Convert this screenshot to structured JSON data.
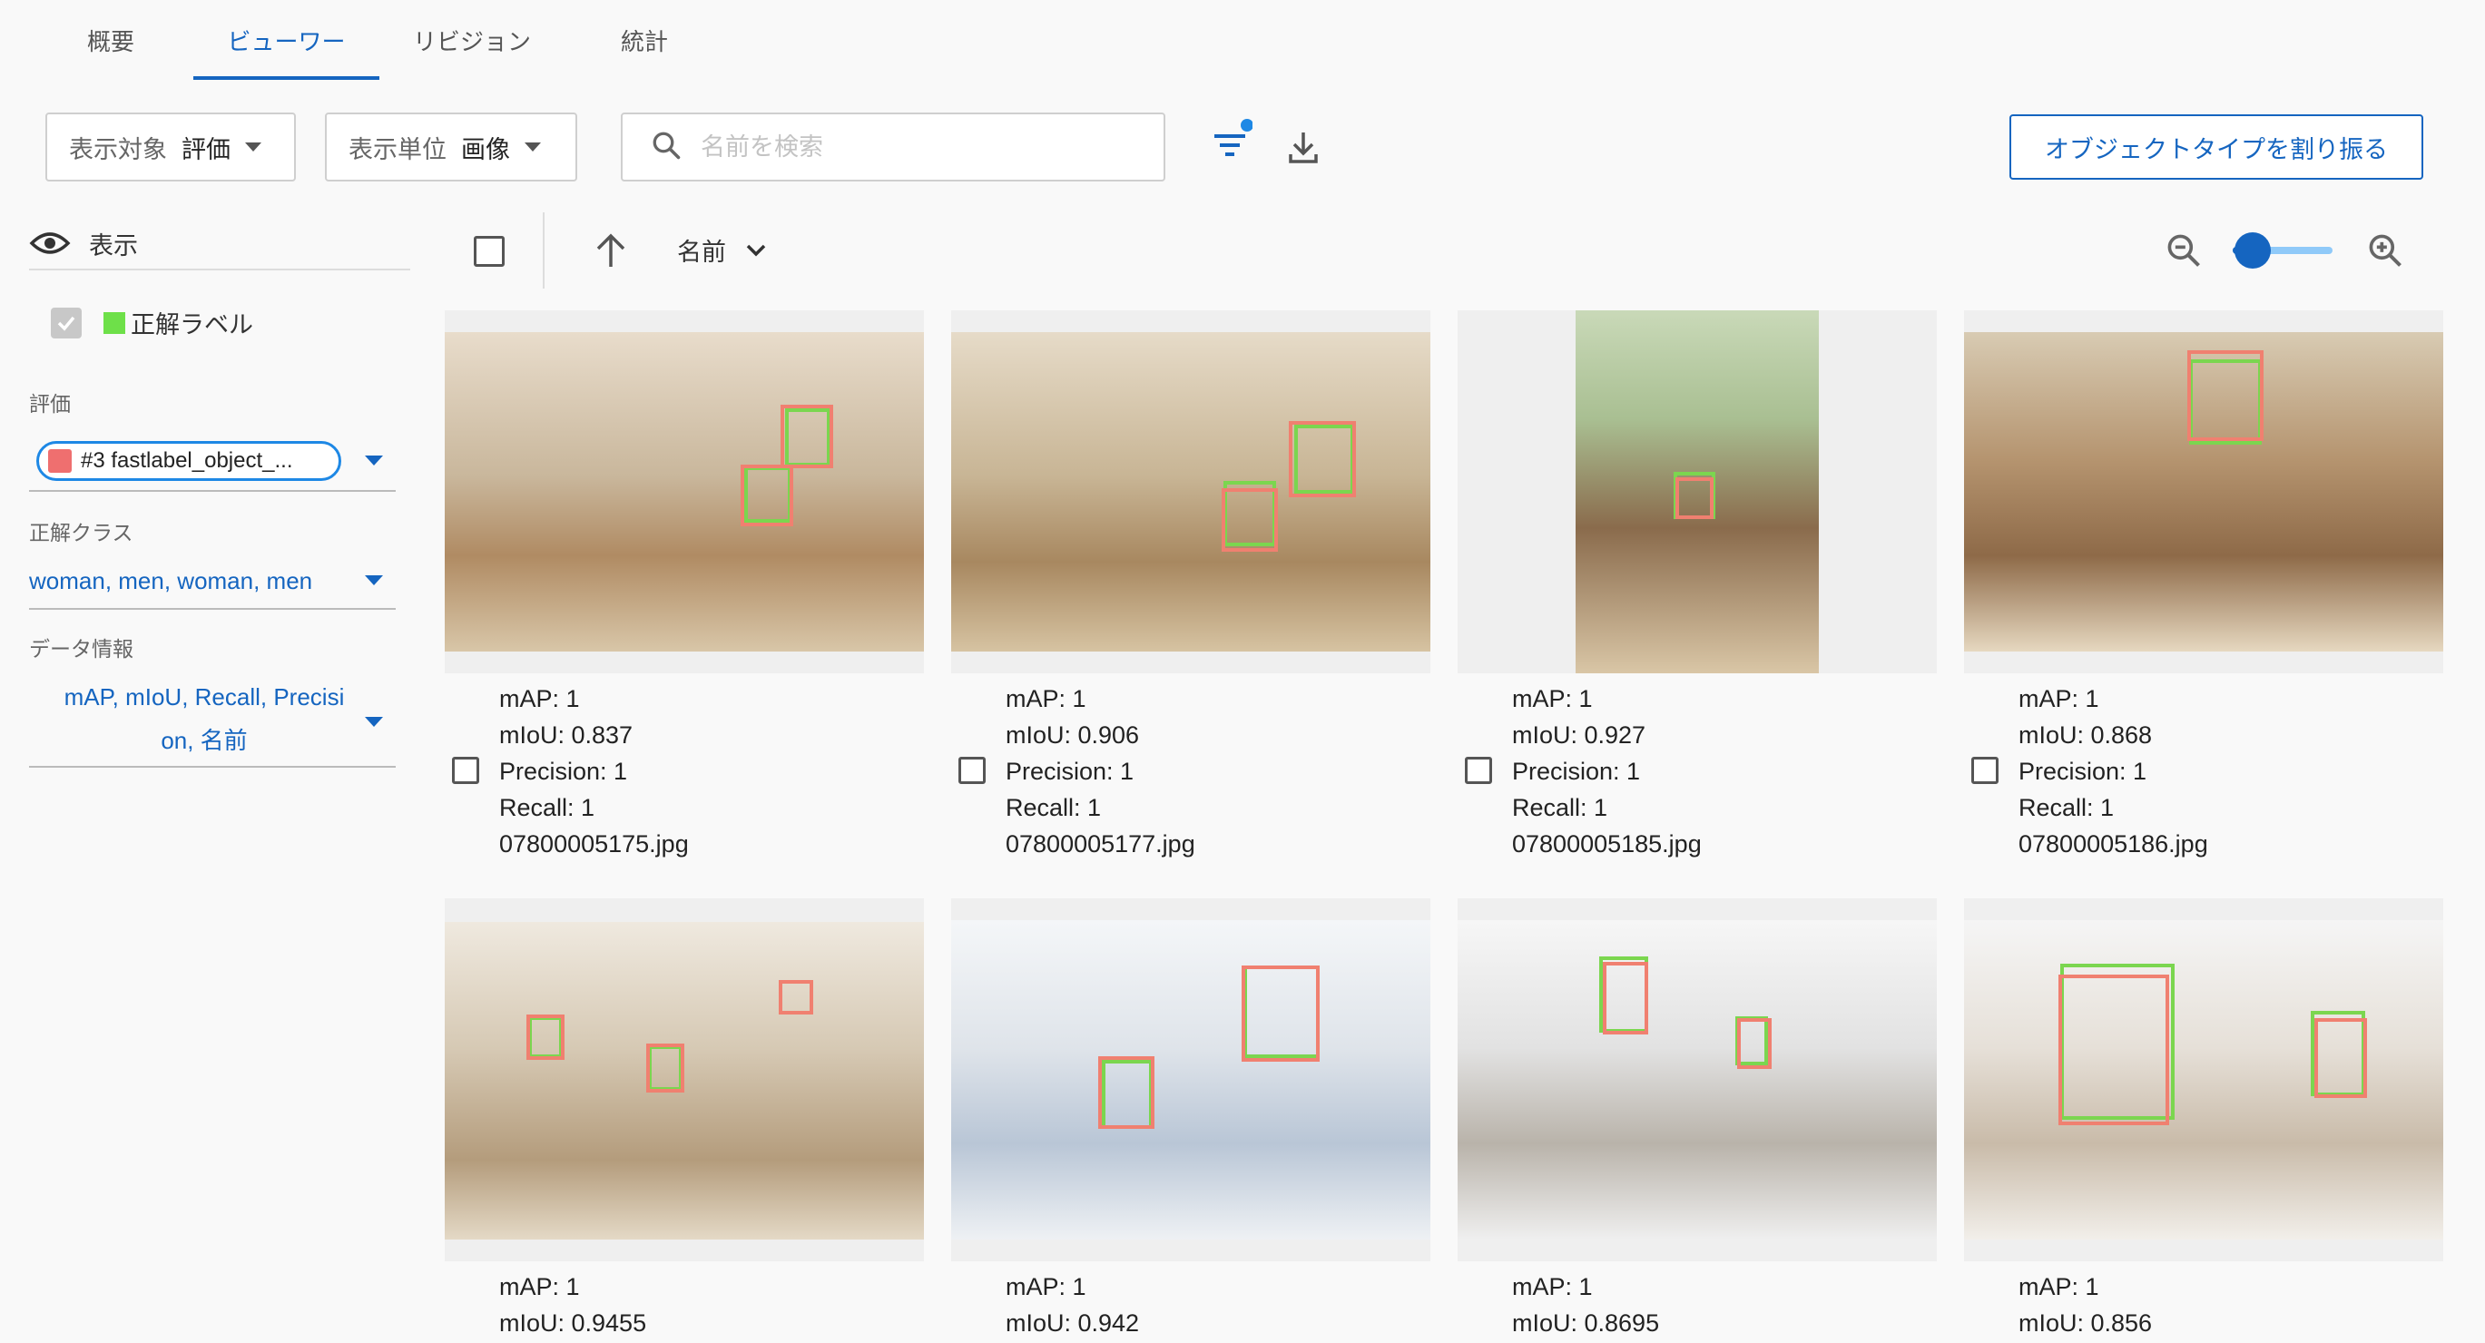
{
  "tabs": [
    "概要",
    "ビューワー",
    "リビジョン",
    "統計"
  ],
  "toolbar": {
    "target_label": "表示対象",
    "target_value": "評価",
    "unit_label": "表示単位",
    "unit_value": "画像",
    "search_placeholder": "名前を検索",
    "assign_button": "オブジェクトタイプを割り振る"
  },
  "sidebar": {
    "display_label": "表示",
    "gt_label": "正解ラベル",
    "eval_label": "評価",
    "eval_chip": "#3 fastlabel_object_...",
    "class_label": "正解クラス",
    "class_value": "woman, men, woman, men",
    "info_label": "データ情報",
    "info_value_line1": "mAP, mIoU, Recall, Precisi",
    "info_value_line2": "on, 名前"
  },
  "grid_header": {
    "sort_label": "名前"
  },
  "colors": {
    "accent": "#1565c0",
    "ground_truth_box": "#7bd64f",
    "prediction_box": "#f08070"
  },
  "cards": [
    {
      "map": "mAP: 1",
      "miou": "mIoU: 0.837",
      "precision": "Precision: 1",
      "recall": "Recall: 1",
      "name": "07800005175.jpg"
    },
    {
      "map": "mAP: 1",
      "miou": "mIoU: 0.906",
      "precision": "Precision: 1",
      "recall": "Recall: 1",
      "name": "07800005177.jpg"
    },
    {
      "map": "mAP: 1",
      "miou": "mIoU: 0.927",
      "precision": "Precision: 1",
      "recall": "Recall: 1",
      "name": "07800005185.jpg"
    },
    {
      "map": "mAP: 1",
      "miou": "mIoU: 0.868",
      "precision": "Precision: 1",
      "recall": "Recall: 1",
      "name": "07800005186.jpg"
    },
    {
      "map": "mAP: 1",
      "miou": "mIoU: 0.9455"
    },
    {
      "map": "mAP: 1",
      "miou": "mIoU: 0.942"
    },
    {
      "map": "mAP: 1",
      "miou": "mIoU: 0.8695"
    },
    {
      "map": "mAP: 1",
      "miou": "mIoU: 0.856"
    }
  ]
}
